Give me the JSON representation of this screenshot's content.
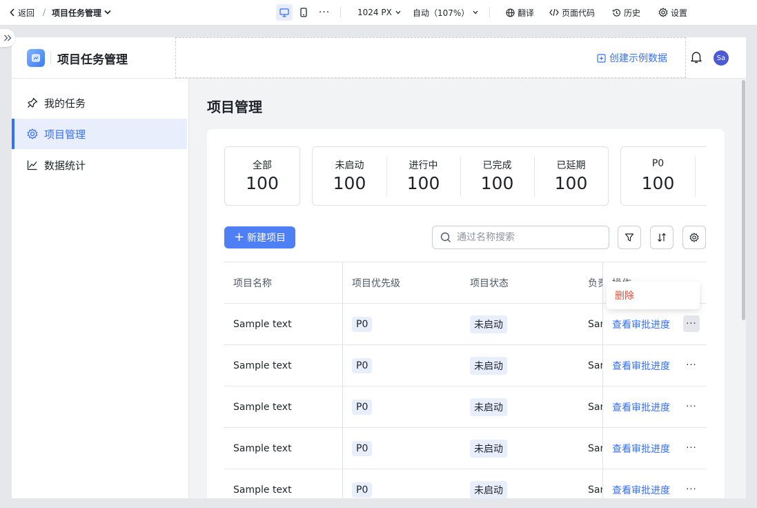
{
  "toolbar": {
    "back_label": "返回",
    "page_name": "项目任务管理",
    "width": "1024 PX",
    "zoom": "自动（107%）",
    "translate": "翻译",
    "page_code": "页面代码",
    "history": "历史",
    "settings": "设置"
  },
  "app": {
    "title": "项目任务管理",
    "create_demo": "创建示例数据",
    "avatar": "Sa"
  },
  "sidebar": {
    "items": [
      {
        "label": "我的任务",
        "icon": "pin-icon"
      },
      {
        "label": "项目管理",
        "icon": "gear-icon",
        "active": true
      },
      {
        "label": "数据统计",
        "icon": "line-chart-icon"
      }
    ]
  },
  "main": {
    "title": "项目管理",
    "stats": {
      "all": {
        "label": "全部",
        "value": "100"
      },
      "status": [
        {
          "label": "未启动",
          "value": "100"
        },
        {
          "label": "进行中",
          "value": "100"
        },
        {
          "label": "已完成",
          "value": "100"
        },
        {
          "label": "已延期",
          "value": "100"
        }
      ],
      "priority": [
        {
          "label": "P0",
          "value": "100"
        }
      ]
    },
    "new_button": "新建项目",
    "search_placeholder": "通过名称搜索",
    "table": {
      "headers": [
        "项目名称",
        "项目优先级",
        "项目状态",
        "负责人",
        "操作"
      ],
      "rows": [
        {
          "name": "Sample text",
          "priority": "P0",
          "status": "未启动",
          "owner": "Sample",
          "action": "查看审批进度"
        },
        {
          "name": "Sample text",
          "priority": "P0",
          "status": "未启动",
          "owner": "Sample",
          "action": "查看审批进度"
        },
        {
          "name": "Sample text",
          "priority": "P0",
          "status": "未启动",
          "owner": "Sample",
          "action": "查看审批进度"
        },
        {
          "name": "Sample text",
          "priority": "P0",
          "status": "未启动",
          "owner": "Sample",
          "action": "查看审批进度"
        },
        {
          "name": "Sample text",
          "priority": "P0",
          "status": "未启动",
          "owner": "Sample",
          "action": "查看审批进度"
        }
      ]
    },
    "popup": {
      "delete": "删除"
    }
  },
  "colors": {
    "accent": "#3370ff",
    "primary_button": "#4e7ff5",
    "danger": "#e34d3b",
    "tag_bg": "#e8eefc"
  }
}
